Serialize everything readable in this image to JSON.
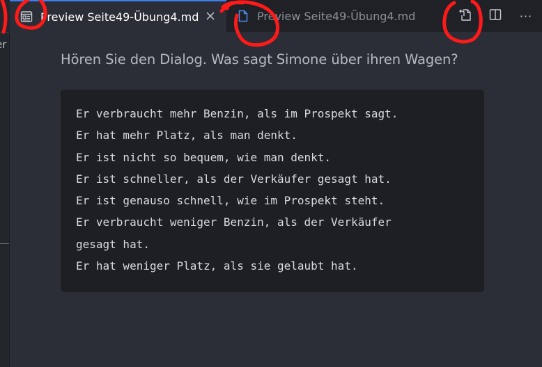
{
  "sidebar": {
    "cut_text": "er"
  },
  "tabs": [
    {
      "label": "Preview Seite49-Übung4.md",
      "active": true,
      "icon": "preview-icon",
      "close_icon": "close-icon"
    },
    {
      "label": "Preview Seite49-Übung4.md",
      "active": false,
      "icon": "file-icon"
    }
  ],
  "toolbar": {
    "actions": [
      {
        "icon": "open-source-icon"
      },
      {
        "icon": "split-editor-icon"
      },
      {
        "icon": "more-actions-icon",
        "glyph": "···"
      }
    ]
  },
  "document": {
    "heading": "Hören Sie den Dialog. Was sagt Simone über ihren Wagen?",
    "code_lines": [
      "Er verbraucht mehr Benzin, als im Prospekt sagt.",
      "Er hat mehr Platz, als man denkt.",
      "Er ist nicht so bequem, wie man denkt.",
      "Er ist schneller, als der Verkäufer gesagt hat.",
      "Er ist genauso schnell, wie im Prospekt steht.",
      "Er verbraucht weniger Benzin, als der Verkäufer",
      "gesagt hat.",
      "Er hat weniger Platz, als sie gelaubt hat."
    ]
  },
  "colors": {
    "accent_tab_border": "#3d7ff0",
    "file_icon": "#4a8ff0",
    "annotation_red": "#ff1a1a"
  }
}
